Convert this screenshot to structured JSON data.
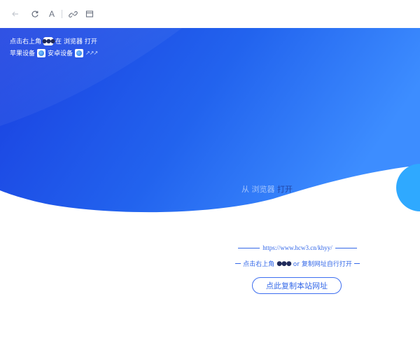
{
  "toolbar": {
    "back_icon": "arrow-left-icon",
    "refresh_icon": "refresh-icon",
    "font_label": "A",
    "link_icon": "link-icon",
    "window_icon": "window-icon"
  },
  "tip": {
    "line1_prefix": "点击右上角",
    "dots": "●●●",
    "line1_suffix_a": "在",
    "line1_suffix_b": "浏览器 打开",
    "line2_apple": "苹果设备",
    "line2_android": "安卓设备",
    "arrows": "↗↗↗"
  },
  "hero": {
    "faded_left": "从 浏览器",
    "faded_right": "打开",
    "gradient_start": "#1a3fe0",
    "gradient_end": "#3d8dff",
    "accent_circle": "#2fa9ff"
  },
  "url": {
    "text": "https://www.hcw3.cn/khyy/"
  },
  "hint": {
    "prefix": "点击右上角",
    "dots": "●●●",
    "suffix": "or 复制网址自行打开"
  },
  "copy_button": {
    "label": "点此复制本站网址"
  },
  "colors": {
    "accent": "#3468e8",
    "hero_blue": "#1f4fe8"
  }
}
